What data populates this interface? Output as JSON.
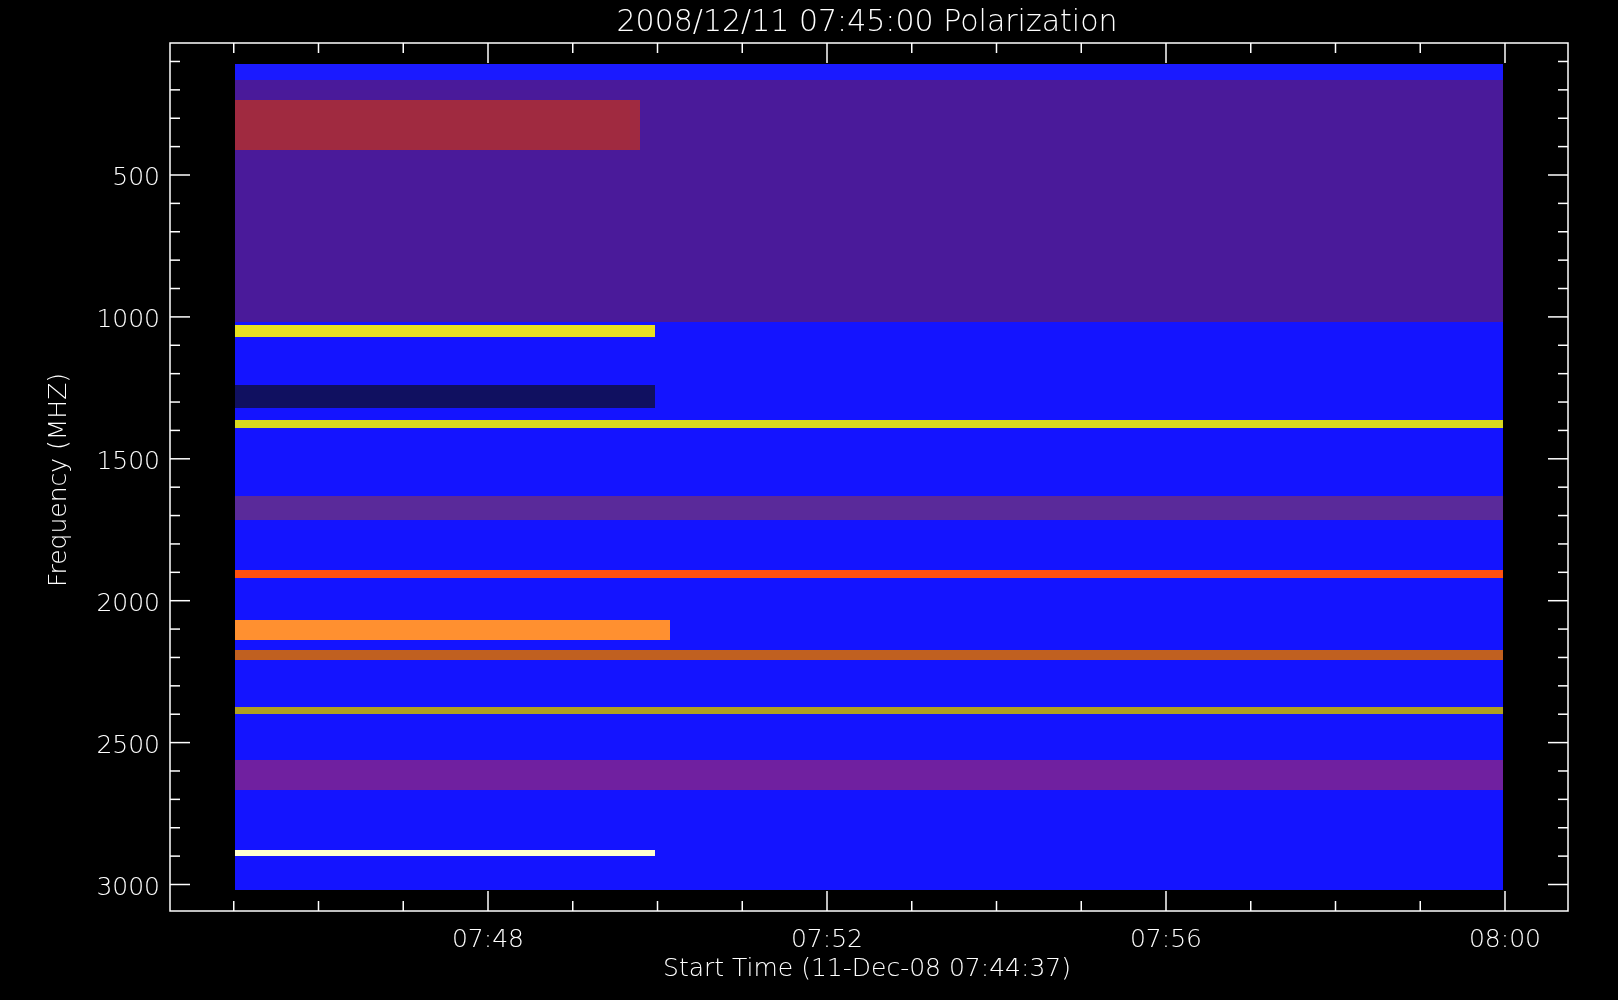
{
  "title": "2008/12/11 07:45:00 Polarization",
  "y_axis": {
    "label": "Frequency (MHZ)",
    "ticks": [
      "500",
      "1000",
      "1500",
      "2000",
      "2500",
      "3000"
    ]
  },
  "x_axis": {
    "label": "Start Time (11-Dec-08 07:44:37)",
    "ticks": [
      "07:48",
      "07:52",
      "07:56",
      "08:00"
    ]
  }
}
